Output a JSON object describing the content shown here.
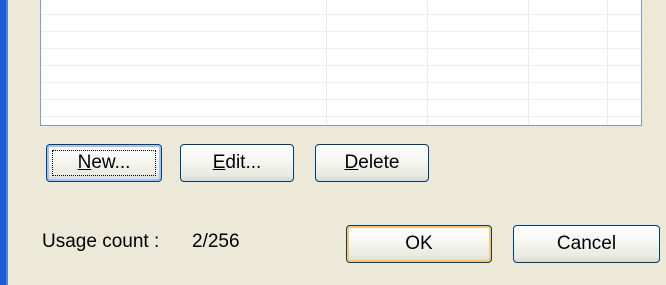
{
  "list": {
    "rows": 7,
    "columns": 5
  },
  "buttons": {
    "new": {
      "mnemonic": "N",
      "rest": "ew..."
    },
    "edit": {
      "mnemonic": "E",
      "rest": "dit..."
    },
    "delete": {
      "mnemonic": "D",
      "rest": "elete"
    },
    "ok": "OK",
    "cancel": "Cancel"
  },
  "usage": {
    "label": "Usage count :",
    "value": "2/256"
  },
  "colors": {
    "window_bg": "#ece9d8",
    "list_bg": "#ffffff",
    "button_border": "#003c74",
    "focus_highlight": "#a9c2f4",
    "default_highlight": "#f6c86a",
    "window_frame": "#1b5fd8"
  }
}
